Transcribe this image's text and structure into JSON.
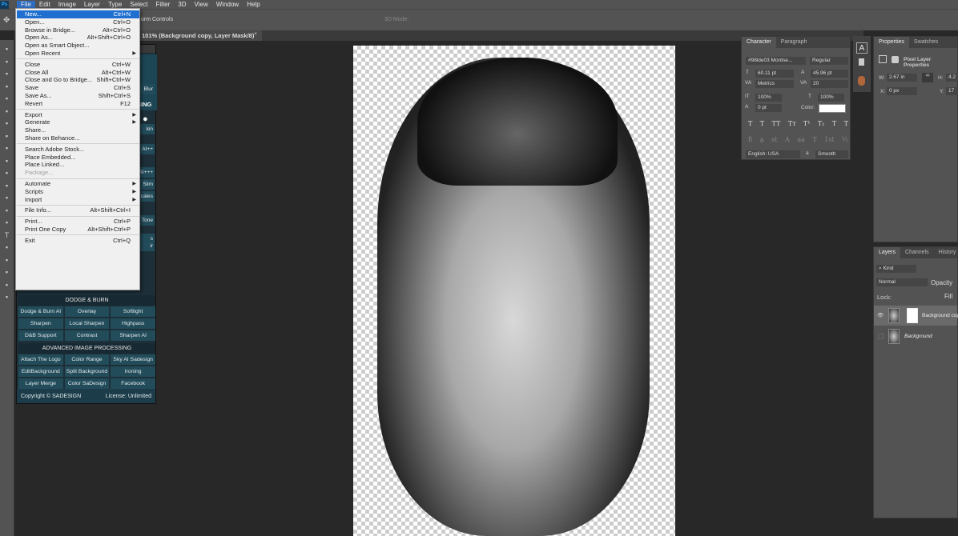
{
  "menubar": {
    "logo": "Ps",
    "items": [
      "File",
      "Edit",
      "Image",
      "Layer",
      "Type",
      "Select",
      "Filter",
      "3D",
      "View",
      "Window",
      "Help"
    ],
    "active": "File"
  },
  "options_bar": {
    "transform_controls": "orm Controls",
    "three_d_mode": "3D Mode:"
  },
  "document_tab": {
    "title": "101% (Background copy, Layer Mask/8)",
    "close": "×"
  },
  "file_menu": {
    "groups": [
      [
        {
          "label": "New...",
          "shortcut": "Ctrl+N",
          "highlighted": true
        },
        {
          "label": "Open...",
          "shortcut": "Ctrl+O"
        },
        {
          "label": "Browse in Bridge...",
          "shortcut": "Alt+Ctrl+O"
        },
        {
          "label": "Open As...",
          "shortcut": "Alt+Shift+Ctrl+O"
        },
        {
          "label": "Open as Smart Object..."
        },
        {
          "label": "Open Recent",
          "submenu": true
        }
      ],
      [
        {
          "label": "Close",
          "shortcut": "Ctrl+W"
        },
        {
          "label": "Close All",
          "shortcut": "Alt+Ctrl+W"
        },
        {
          "label": "Close and Go to Bridge...",
          "shortcut": "Shift+Ctrl+W"
        },
        {
          "label": "Save",
          "shortcut": "Ctrl+S"
        },
        {
          "label": "Save As...",
          "shortcut": "Shift+Ctrl+S"
        },
        {
          "label": "Revert",
          "shortcut": "F12"
        }
      ],
      [
        {
          "label": "Export",
          "submenu": true
        },
        {
          "label": "Generate",
          "submenu": true
        },
        {
          "label": "Share..."
        },
        {
          "label": "Share on Behance..."
        }
      ],
      [
        {
          "label": "Search Adobe Stock..."
        },
        {
          "label": "Place Embedded..."
        },
        {
          "label": "Place Linked..."
        },
        {
          "label": "Package...",
          "disabled": true
        }
      ],
      [
        {
          "label": "Automate",
          "submenu": true
        },
        {
          "label": "Scripts",
          "submenu": true
        },
        {
          "label": "Import",
          "submenu": true
        }
      ],
      [
        {
          "label": "File Info...",
          "shortcut": "Alt+Shift+Ctrl+I"
        }
      ],
      [
        {
          "label": "Print...",
          "shortcut": "Ctrl+P"
        },
        {
          "label": "Print One Copy",
          "shortcut": "Alt+Shift+Ctrl+P"
        }
      ],
      [
        {
          "label": "Exit",
          "shortcut": "Ctrl+Q"
        }
      ]
    ]
  },
  "plugin": {
    "brand_partial": "SING",
    "partial_buttons": [
      "Blur",
      "kin",
      "AI++",
      "AI+++",
      "Slim",
      "cales",
      "Tone",
      "s",
      "ir"
    ],
    "dodge_burn": {
      "title": "DODGE & BURN",
      "buttons": [
        "Dodge & Burn AI",
        "Overlay",
        "Softlight",
        "Sharpen",
        "Local Sharpen",
        "Highpass",
        "D&B Support",
        "Contrast",
        "Sharpen AI"
      ]
    },
    "advanced": {
      "title": "ADVANCED IMAGE PROCESSING",
      "buttons": [
        "Attach The Logo",
        "Color Range",
        "Sky AI Sadesign",
        "EditBackground",
        "Split Background",
        "Ironing",
        "Layer Merge",
        "Color SaDesign",
        "Facebook"
      ]
    },
    "copyright": "Copyright © SADESIGN",
    "license": "License: Unlimited"
  },
  "character": {
    "tabs": [
      "Character",
      "Paragraph"
    ],
    "font": "#98lde03 Montse...",
    "style": "Regular",
    "size": "60.11 pt",
    "leading": "45.96 pt",
    "kerning": "Metrics",
    "tracking": "20",
    "vscale": "100%",
    "hscale": "100%",
    "baseline": "0 pt",
    "color_label": "Color:",
    "color": "#ffffff",
    "type_buttons": [
      "T",
      "T",
      "TT",
      "Tт",
      "T¹",
      "T₁",
      "T",
      "T"
    ],
    "ot_buttons": [
      "ﬁ",
      "ꝺ",
      "st",
      "A",
      "aa",
      "T",
      "1st",
      "½"
    ],
    "language": "English: USA",
    "aa_label": "a",
    "antialias": "Smooth"
  },
  "properties": {
    "tabs": [
      "Properties",
      "Swatches"
    ],
    "title": "Pixel Layer Properties",
    "w_label": "W:",
    "w": "2.67 in",
    "h_label": "H:",
    "h": "4.2",
    "x_label": "X:",
    "x": "0 px",
    "y_label": "Y:",
    "y": "17"
  },
  "layers": {
    "tabs": [
      "Layers",
      "Channels",
      "History"
    ],
    "filter": "Kind",
    "blend": "Normal",
    "opacity_label": "Opacity",
    "lock_label": "Lock:",
    "fill_label": "Fill",
    "items": [
      {
        "name": "Background copy",
        "visible": true,
        "mask": true
      },
      {
        "name": "Background",
        "visible": false,
        "italic": true
      }
    ]
  }
}
